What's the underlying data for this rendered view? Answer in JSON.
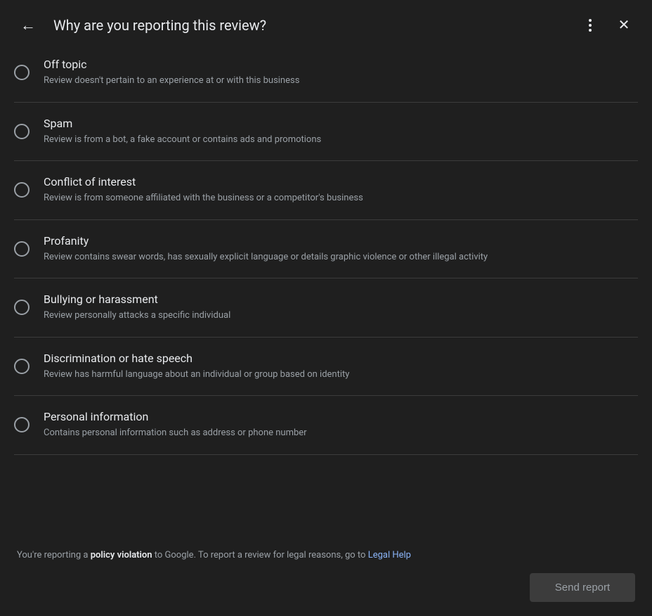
{
  "header": {
    "title": "Why are you reporting this review?",
    "back_label": "←",
    "more_label": "⋮",
    "close_label": "✕"
  },
  "options": [
    {
      "id": "off-topic",
      "title": "Off topic",
      "description": "Review doesn't pertain to an experience at or with this business",
      "selected": false
    },
    {
      "id": "spam",
      "title": "Spam",
      "description": "Review is from a bot, a fake account or contains ads and promotions",
      "selected": false
    },
    {
      "id": "conflict-of-interest",
      "title": "Conflict of interest",
      "description": "Review is from someone affiliated with the business or a competitor's business",
      "selected": false
    },
    {
      "id": "profanity",
      "title": "Profanity",
      "description": "Review contains swear words, has sexually explicit language or details graphic violence or other illegal activity",
      "selected": false
    },
    {
      "id": "bullying-harassment",
      "title": "Bullying or harassment",
      "description": "Review personally attacks a specific individual",
      "selected": false
    },
    {
      "id": "discrimination-hate",
      "title": "Discrimination or hate speech",
      "description": "Review has harmful language about an individual or group based on identity",
      "selected": false
    },
    {
      "id": "personal-info",
      "title": "Personal information",
      "description": "Contains personal information such as address or phone number",
      "selected": false
    }
  ],
  "footer": {
    "text_before": "You're reporting a ",
    "text_bold": "policy violation",
    "text_middle": " to Google. To report a review for legal reasons, go to ",
    "link_text": "Legal Help",
    "send_button": "Send report"
  },
  "colors": {
    "background": "#1f1f1f",
    "text_primary": "#e8eaed",
    "text_secondary": "#9aa0a6",
    "divider": "#3c3c3c",
    "link": "#8ab4f8",
    "button_bg": "#3c3c3c",
    "button_text": "#9aa0a6"
  }
}
